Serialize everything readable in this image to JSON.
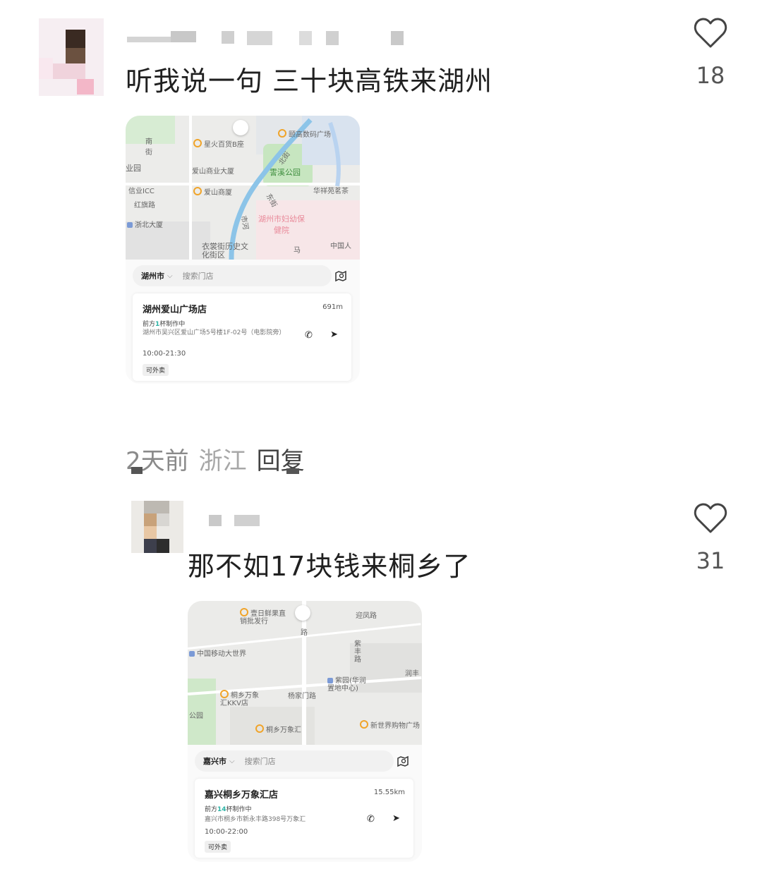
{
  "comments": [
    {
      "text": "听我说一句 三十块高铁来湖州",
      "likes": "18",
      "meta": {
        "time": "2天前",
        "location": "浙江",
        "reply": "回复"
      },
      "map_card": {
        "city": "湖州市",
        "search_placeholder": "搜索门店",
        "store_name": "湖州爱山广场店",
        "distance": "691m",
        "queue_prefix": "前方",
        "queue_count": "1",
        "queue_suffix": "杯制作中",
        "address": "湖州市吴兴区爱山广场5号楼1F-02号（电影院旁）",
        "hours": "10:00-21:30",
        "tag": "可外卖",
        "map_labels": [
          "南街",
          "星火百货B座",
          "颐高数码广场",
          "北街",
          "霅溪公园",
          "爱山商业大厦",
          "业园",
          "信业ICC",
          "红旗路",
          "爱山商厦",
          "东街",
          "华祥苑茗茶",
          "浙北大厦",
          "市河",
          "湖州市妇幼保健院",
          "衣裳街历史文化街区",
          "中国人",
          "马"
        ]
      }
    },
    {
      "text": "那不如17块钱来桐乡了",
      "likes": "31",
      "map_card": {
        "city": "嘉兴市",
        "search_placeholder": "搜索门店",
        "store_name": "嘉兴桐乡万象汇店",
        "distance": "15.55km",
        "queue_prefix": "前方",
        "queue_count": "14",
        "queue_suffix": "杯制作中",
        "address": "嘉兴市桐乡市新永丰路398号万象汇",
        "hours": "10:00-22:00",
        "tag": "可外卖",
        "map_labels": [
          "壹日鲜果直销批发行",
          "迎凤路",
          "路",
          "中国移动大世界",
          "紫丰路",
          "润丰",
          "紫园(华润置地中心)",
          "桐乡万象汇KKV店",
          "杨家门路",
          "公园",
          "桐乡万象汇",
          "新世界购物广场"
        ]
      }
    }
  ]
}
